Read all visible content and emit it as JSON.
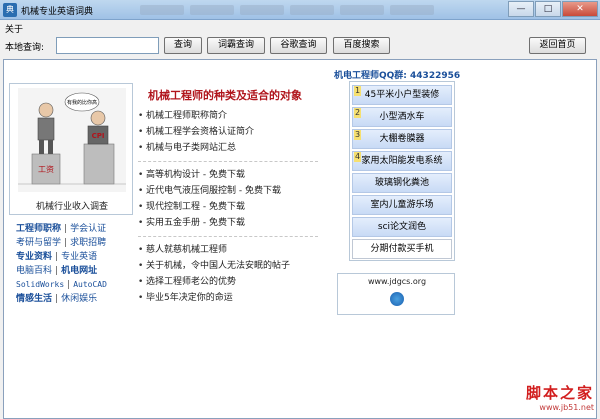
{
  "window": {
    "title": "机械专业英语词典",
    "controls": {
      "min": "—",
      "max": "□",
      "close": "✕"
    }
  },
  "menu": {
    "about": "关于"
  },
  "toolbar": {
    "search_label": "本地查询:",
    "search_value": "",
    "buttons": {
      "query": "查询",
      "ciba": "词霸查询",
      "google": "谷歌查询",
      "baidu": "百度搜索",
      "home": "返回首页"
    }
  },
  "qq": {
    "text": "机电工程师QQ群: 44322956"
  },
  "left": {
    "caption": "机械行业收入调查",
    "cartoon_labels": {
      "wage": "工资",
      "cpi": "CPI",
      "bubble": "有我的比你高"
    },
    "links": [
      [
        "工程师职称",
        "学会认证"
      ],
      [
        "考研与留学",
        "求职招聘"
      ],
      [
        "专业资料",
        "专业英语"
      ],
      [
        "电脑百科",
        "机电网址"
      ],
      [
        "SolidWorks",
        "AutoCAD"
      ],
      [
        "情感生活",
        "休闲娱乐"
      ]
    ]
  },
  "center": {
    "title": "机械工程师的种类及适合的对象",
    "group1": [
      "机械工程师职称简介",
      "机械工程学会资格认证简介",
      "机械与电子类网站汇总"
    ],
    "group2": [
      "高等机构设计 - 免费下载",
      "近代电气液压伺服控制 - 免费下载",
      "现代控制工程 - 免费下载",
      "实用五金手册 - 免费下载"
    ],
    "group3": [
      "慈人就慈机械工程师",
      "关于机械，令中国人无法安眠的帖子",
      "选择工程师老公的优势",
      "毕业5年决定你的命运"
    ]
  },
  "ads": {
    "items": [
      {
        "num": "1",
        "label": "45平米小户型装修"
      },
      {
        "num": "2",
        "label": "小型洒水车"
      },
      {
        "num": "3",
        "label": "大棚卷膜器"
      },
      {
        "num": "4",
        "label": "家用太阳能发电系统"
      },
      {
        "num": "",
        "label": "玻璃钢化粪池"
      },
      {
        "num": "",
        "label": "室内儿童游乐场"
      },
      {
        "num": "",
        "label": "sci论文润色"
      }
    ],
    "last": "分期付款买手机"
  },
  "site": {
    "url": "www.jdgcs.org"
  },
  "watermark": {
    "main": "脚本之家",
    "sub": "www.jb51.net"
  },
  "colors": {
    "link": "#1a4f9a",
    "title_red": "#b0151c",
    "watermark": "#d21e1e"
  }
}
